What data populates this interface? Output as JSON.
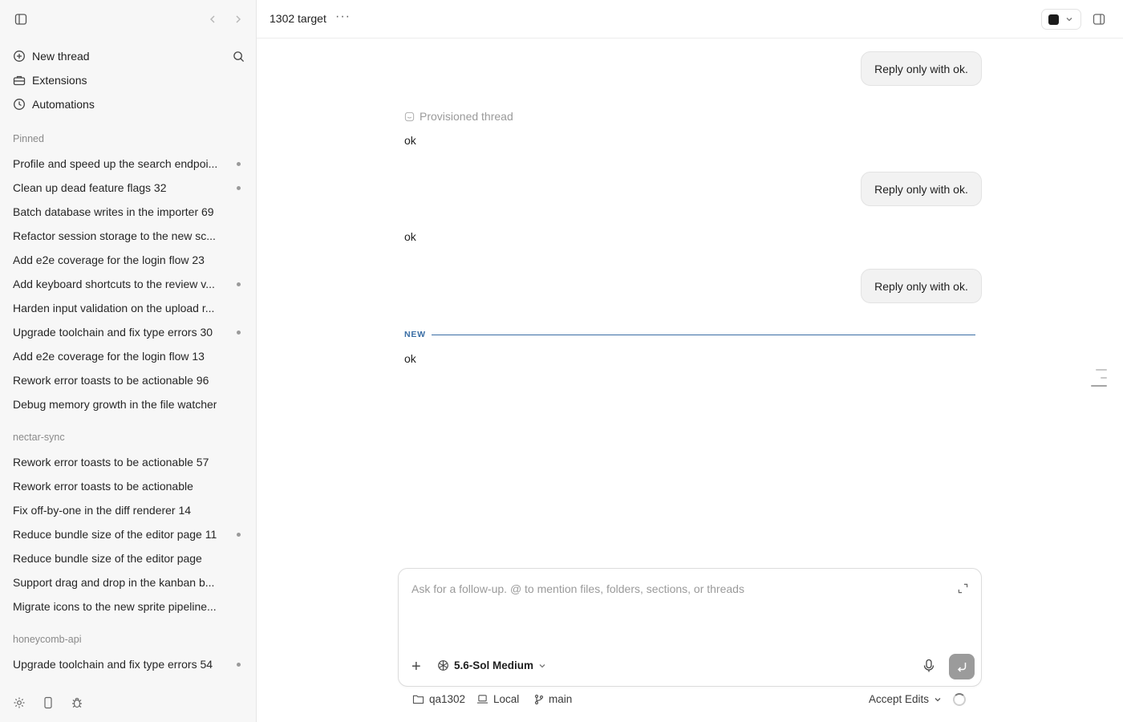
{
  "sidebar": {
    "nav": {
      "new_thread": "New thread",
      "extensions": "Extensions",
      "automations": "Automations"
    },
    "pinned": {
      "label": "Pinned",
      "threads": [
        {
          "label": "Profile and speed up the search endpoi...",
          "dot": true
        },
        {
          "label": "Clean up dead feature flags 32",
          "dot": true
        },
        {
          "label": "Batch database writes in the importer 69",
          "dot": false
        },
        {
          "label": "Refactor session storage to the new sc...",
          "dot": false
        },
        {
          "label": "Add e2e coverage for the login flow 23",
          "dot": false
        },
        {
          "label": "Add keyboard shortcuts to the review v...",
          "dot": true
        },
        {
          "label": "Harden input validation on the upload r...",
          "dot": false
        },
        {
          "label": "Upgrade toolchain and fix type errors 30",
          "dot": true
        },
        {
          "label": "Add e2e coverage for the login flow 13",
          "dot": false
        },
        {
          "label": "Rework error toasts to be actionable 96",
          "dot": false
        },
        {
          "label": "Debug memory growth in the file watcher",
          "dot": false
        }
      ]
    },
    "nectar_sync": {
      "label": "nectar-sync",
      "threads": [
        {
          "label": "Rework error toasts to be actionable 57",
          "dot": false
        },
        {
          "label": "Rework error toasts to be actionable",
          "dot": false
        },
        {
          "label": "Fix off-by-one in the diff renderer 14",
          "dot": false
        },
        {
          "label": "Reduce bundle size of the editor page 11",
          "dot": true
        },
        {
          "label": "Reduce bundle size of the editor page",
          "dot": false
        },
        {
          "label": "Support drag and drop in the kanban b...",
          "dot": false
        },
        {
          "label": "Migrate icons to the new sprite pipeline...",
          "dot": false
        }
      ]
    },
    "honeycomb_api": {
      "label": "honeycomb-api",
      "threads": [
        {
          "label": "Upgrade toolchain and fix type errors 54",
          "dot": true
        }
      ]
    }
  },
  "header": {
    "title": "1302 target",
    "more": "···"
  },
  "conversation": {
    "user_1": "Reply only with ok.",
    "provisioned": "Provisioned thread",
    "reply_1": "ok",
    "user_2": "Reply only with ok.",
    "reply_2": "ok",
    "user_3": "Reply only with ok.",
    "new_label": "NEW",
    "reply_3": "ok"
  },
  "composer": {
    "placeholder": "Ask for a follow-up. @ to mention files, folders, sections, or threads",
    "model": "5.6-Sol Medium"
  },
  "footer": {
    "folder": "qa1302",
    "env": "Local",
    "branch": "main",
    "mode": "Accept Edits"
  }
}
